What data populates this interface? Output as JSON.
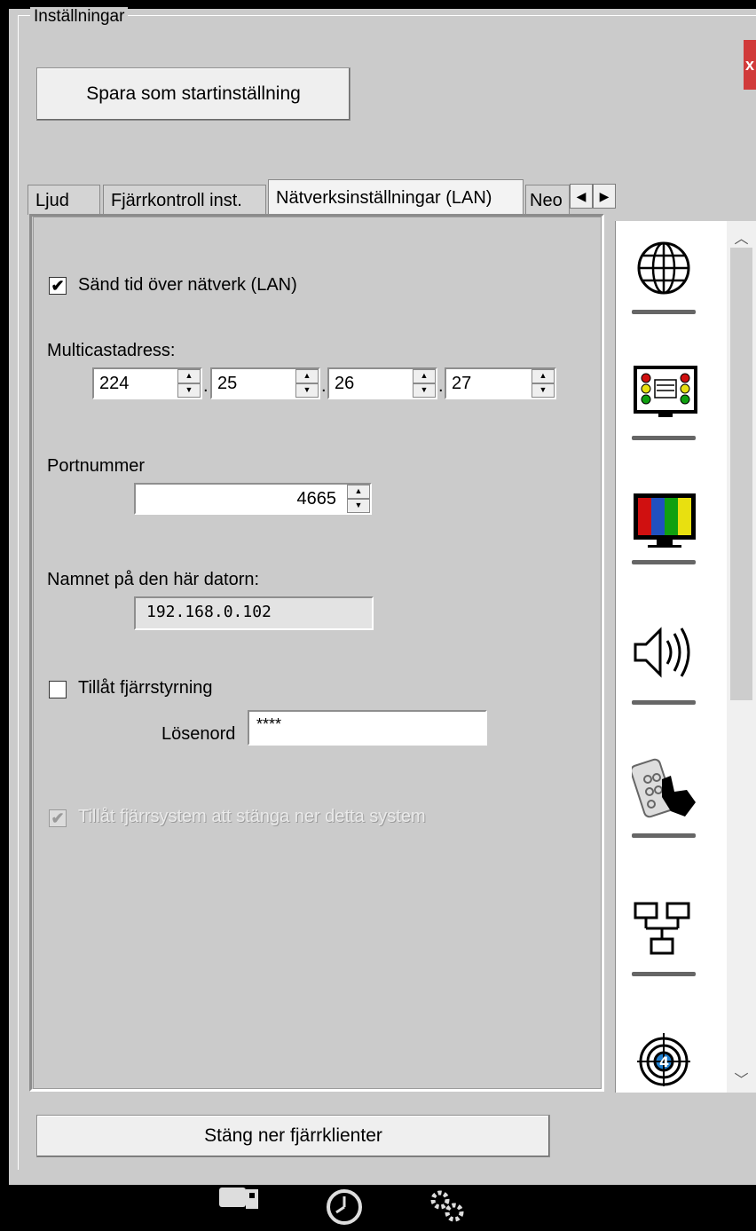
{
  "window": {
    "group_title": "Inställningar",
    "close_label": "x"
  },
  "buttons": {
    "save_start": "Spara som startinställning",
    "shutdown_clients": "Stäng ner fjärrklienter"
  },
  "tabs": [
    {
      "label": "Ljud"
    },
    {
      "label": "Fjärrkontroll inst."
    },
    {
      "label": "Nätverksinställningar (LAN)"
    },
    {
      "label": "Neo"
    }
  ],
  "network": {
    "send_time_label": "Sänd tid över nätverk (LAN)",
    "send_time_checked": true,
    "multicast_label": "Multicastadress:",
    "multicast": [
      "224",
      "25",
      "26",
      "27"
    ],
    "multicast_separator": ".",
    "port_label": "Portnummer",
    "port_value": "4665",
    "computer_name_label": "Namnet på den här datorn:",
    "computer_name_value": "192.168.0.102",
    "allow_remote_label": "Tillåt fjärrstyrning",
    "allow_remote_checked": false,
    "password_label": "Lösenord",
    "password_value": "****",
    "allow_shutdown_label": "Tillåt fjärrsystem att stänga ner detta system",
    "allow_shutdown_checked": true,
    "allow_shutdown_disabled": true
  },
  "sidebar_icons": [
    "globe-icon",
    "traffic-light-display-icon",
    "color-bars-tv-icon",
    "speaker-icon",
    "remote-control-hand-icon",
    "network-computers-icon",
    "target-4-icon"
  ],
  "taskbar_icons": [
    "device-icon",
    "clock-icon",
    "gears-icon"
  ],
  "colors": {
    "background": "#cbcbcb",
    "close_button": "#d13a3a",
    "bar_red": "#d01010",
    "bar_green": "#10a010",
    "bar_yellow": "#e8e010"
  }
}
